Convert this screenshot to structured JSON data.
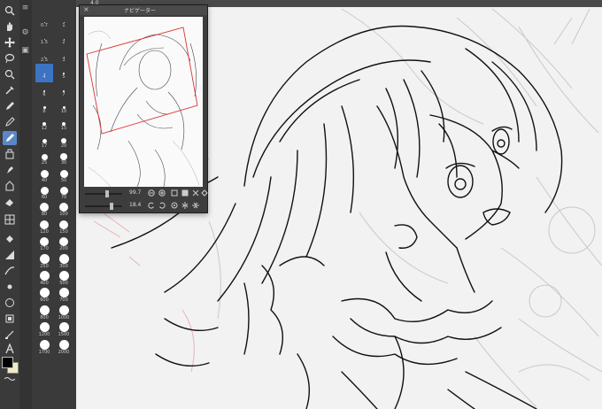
{
  "ruler": {
    "label": "4.0"
  },
  "navigator": {
    "title": "ナビゲーター",
    "zoom_value": "99.7",
    "rotate_value": "18.4"
  },
  "brush_sizes": [
    {
      "label": "0.7",
      "d": 1
    },
    {
      "label": "1",
      "d": 1
    },
    {
      "label": "1.5",
      "d": 1
    },
    {
      "label": "2",
      "d": 1
    },
    {
      "label": "2.5",
      "d": 1
    },
    {
      "label": "3",
      "d": 1
    },
    {
      "label": "4",
      "d": 1
    },
    {
      "label": "5",
      "d": 2
    },
    {
      "label": "6",
      "d": 2
    },
    {
      "label": "7",
      "d": 2
    },
    {
      "label": "8",
      "d": 3
    },
    {
      "label": "10",
      "d": 3
    },
    {
      "label": "12",
      "d": 4
    },
    {
      "label": "15",
      "d": 4
    },
    {
      "label": "17",
      "d": 5
    },
    {
      "label": "20",
      "d": 6
    },
    {
      "label": "25",
      "d": 7
    },
    {
      "label": "30",
      "d": 8
    },
    {
      "label": "40",
      "d": 9
    },
    {
      "label": "50",
      "d": 9
    },
    {
      "label": "60",
      "d": 9
    },
    {
      "label": "70",
      "d": 9
    },
    {
      "label": "80",
      "d": 10
    },
    {
      "label": "100",
      "d": 10
    },
    {
      "label": "120",
      "d": 10
    },
    {
      "label": "150",
      "d": 10
    },
    {
      "label": "170",
      "d": 10
    },
    {
      "label": "200",
      "d": 10
    },
    {
      "label": "250",
      "d": 11
    },
    {
      "label": "300",
      "d": 11
    },
    {
      "label": "400",
      "d": 11
    },
    {
      "label": "500",
      "d": 11
    },
    {
      "label": "600",
      "d": 11
    },
    {
      "label": "700",
      "d": 11
    },
    {
      "label": "800",
      "d": 11
    },
    {
      "label": "1000",
      "d": 11
    },
    {
      "label": "1200",
      "d": 11
    },
    {
      "label": "1500",
      "d": 11
    },
    {
      "label": "1700",
      "d": 11
    },
    {
      "label": "2000",
      "d": 11
    }
  ],
  "selected_brush_index": 6,
  "colors": {
    "accent": "#5a88c6",
    "main_color": "#000000",
    "sub_color": "#f5e9c8"
  }
}
